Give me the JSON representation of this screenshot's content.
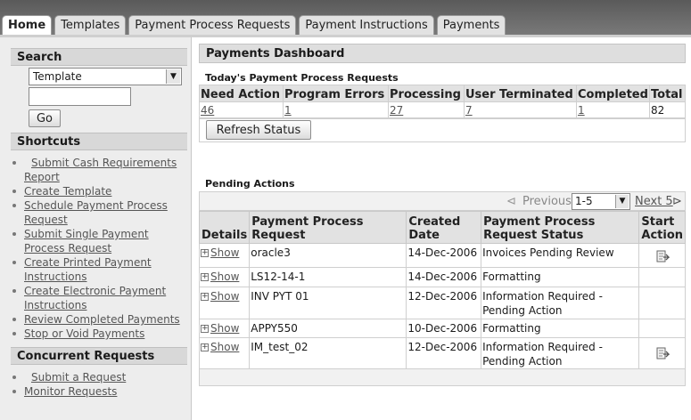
{
  "tabs": [
    {
      "label": "Home",
      "active": true
    },
    {
      "label": "Templates"
    },
    {
      "label": "Payment Process Requests"
    },
    {
      "label": "Payment Instructions"
    },
    {
      "label": "Payments"
    }
  ],
  "sidebar": {
    "search": {
      "heading": "Search",
      "select_value": "Template",
      "go_label": "Go"
    },
    "shortcuts": {
      "heading": "Shortcuts",
      "items": [
        "Submit Cash Requirements Report",
        "Create Template",
        "Schedule Payment Process Request",
        "Submit Single Payment Process Request",
        "Create Printed Payment Instructions",
        "Create Electronic Payment Instructions",
        "Review Completed Payments",
        "Stop or Void Payments"
      ]
    },
    "concurrent": {
      "heading": "Concurrent Requests",
      "items": [
        "Submit a Request",
        "Monitor Requests"
      ]
    }
  },
  "dashboard": {
    "title": "Payments Dashboard",
    "today_title": "Today's Payment Process Requests",
    "summary_headers": [
      "Need Action",
      "Program Errors",
      "Processing",
      "User Terminated",
      "Completed",
      "Total"
    ],
    "summary_values": [
      "46",
      "1",
      "27",
      "7",
      "1",
      "82"
    ],
    "refresh_label": "Refresh Status",
    "pending_title": "Pending Actions",
    "pager": {
      "previous": "Previous",
      "range": "1-5",
      "next": "Next 5"
    },
    "pending_headers": {
      "details": "Details",
      "request": "Payment Process Request",
      "created": "Created Date",
      "status": "Payment Process Request Status",
      "start": "Start Action"
    },
    "show_label": "Show",
    "rows": [
      {
        "request": "oracle3",
        "created": "14-Dec-2006",
        "status": "Invoices Pending Review",
        "action": true
      },
      {
        "request": "LS12-14-1",
        "created": "14-Dec-2006",
        "status": "Formatting",
        "action": false
      },
      {
        "request": "INV PYT 01",
        "created": "12-Dec-2006",
        "status": "Information Required - Pending Action",
        "action": false
      },
      {
        "request": "APPY550",
        "created": "10-Dec-2006",
        "status": "Formatting",
        "action": false
      },
      {
        "request": "IM_test_02",
        "created": "12-Dec-2006",
        "status": "Information Required - Pending Action",
        "action": true
      }
    ]
  }
}
